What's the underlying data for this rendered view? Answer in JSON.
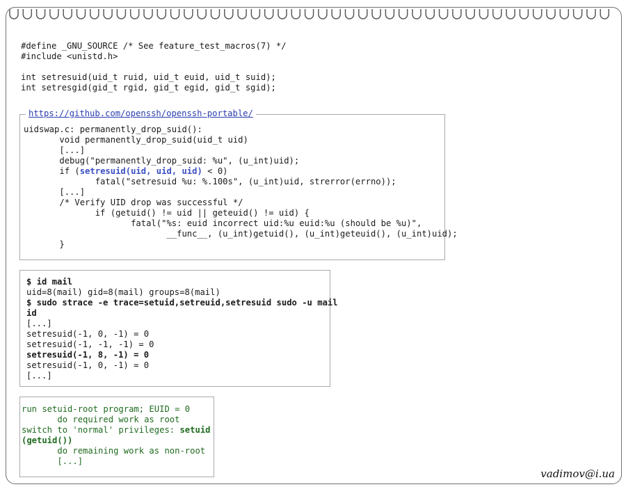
{
  "prototypes": {
    "line1": "#define _GNU_SOURCE /* See feature_test_macros(7) */",
    "line2": "#include <unistd.h>",
    "line3": "",
    "line4": "int setresuid(uid_t ruid, uid_t euid, uid_t suid);",
    "line5": "int setresgid(gid_t rgid, gid_t egid, gid_t sgid);"
  },
  "code_box": {
    "link": "https://github.com/openssh/openssh-portable/",
    "l1": "uidswap.c: permanently_drop_suid():",
    "l2": "       void permanently_drop_suid(uid_t uid)",
    "l3": "       [...]",
    "l4": "       debug(\"permanently_drop_suid: %u\", (u_int)uid);",
    "l5_pre": "       if (",
    "l5_hl": "setresuid(uid, uid, uid)",
    "l5_post": " < 0)",
    "l6": "              fatal(\"setresuid %u: %.100s\", (u_int)uid, strerror(errno));",
    "l7": "       [...]",
    "l8": "       /* Verify UID drop was successful */",
    "l9": "              if (getuid() != uid || geteuid() != uid) {",
    "l10": "                     fatal(\"%s: euid incorrect uid:%u euid:%u (should be %u)\",",
    "l11": "                            __func__, (u_int)getuid(), (u_int)geteuid(), (u_int)uid);",
    "l12": "       }"
  },
  "strace_box": {
    "l1": "$ id mail",
    "l2": "uid=8(mail) gid=8(mail) groups=8(mail)",
    "l3": "$ sudo strace -e trace=setuid,setreuid,setresuid sudo -u mail",
    "l4": "id",
    "l5": "[...]",
    "l6": "setresuid(-1, 0, -1) = 0",
    "l7": "setresuid(-1, -1, -1) = 0",
    "l8": "setresuid(-1, 8, -1) = 0",
    "l9": "setresuid(-1, 0, -1) = 0",
    "l10": "[...]"
  },
  "pseudo_box": {
    "l1": "run setuid-root program; EUID = 0",
    "l2": "       do required work as root",
    "l3_pre": "switch to 'normal' privileges: ",
    "l3_b": "setuid",
    "l4": "(getuid())",
    "l5": "       do remaining work as non-root",
    "l6": "       [...]"
  },
  "signature": "vadimov@i.ua",
  "colors": {
    "link": "#2a3db0",
    "highlight": "#3b4fc4",
    "pseudo_text": "#1f6b1f",
    "border": "#a9a9a9"
  }
}
